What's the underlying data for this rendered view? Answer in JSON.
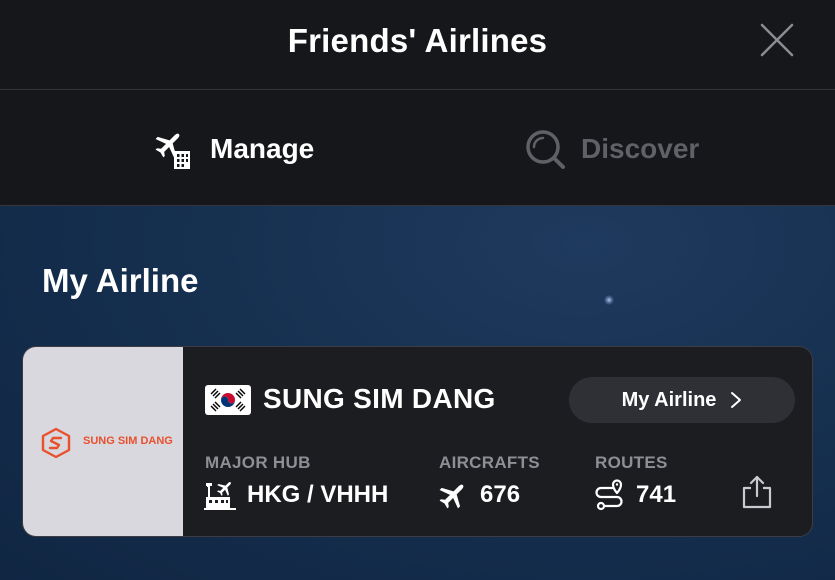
{
  "header": {
    "title": "Friends' Airlines",
    "close_icon": "close-icon"
  },
  "tabs": [
    {
      "label": "Manage",
      "icon": "plane-building-icon",
      "active": true
    },
    {
      "label": "Discover",
      "icon": "search-icon",
      "active": false
    }
  ],
  "main": {
    "section_title": "My Airline",
    "airline": {
      "logo_text": "SUNG SIM DANG",
      "logo_color": "#e8502e",
      "flag": "south-korea-flag-icon",
      "name": "SUNG SIM DANG",
      "button_label": "My Airline",
      "stats": {
        "hub_label": "MAJOR HUB",
        "hub_value": "HKG / VHHH",
        "aircraft_label": "AIRCRAFTS",
        "aircraft_value": "676",
        "routes_label": "ROUTES",
        "routes_value": "741"
      }
    }
  },
  "colors": {
    "header_bg": "#16171a",
    "main_bg": "#163050",
    "card_bg": "#1c1d21",
    "inactive_tab": "#5f6166",
    "stat_label": "#8d8f95"
  }
}
